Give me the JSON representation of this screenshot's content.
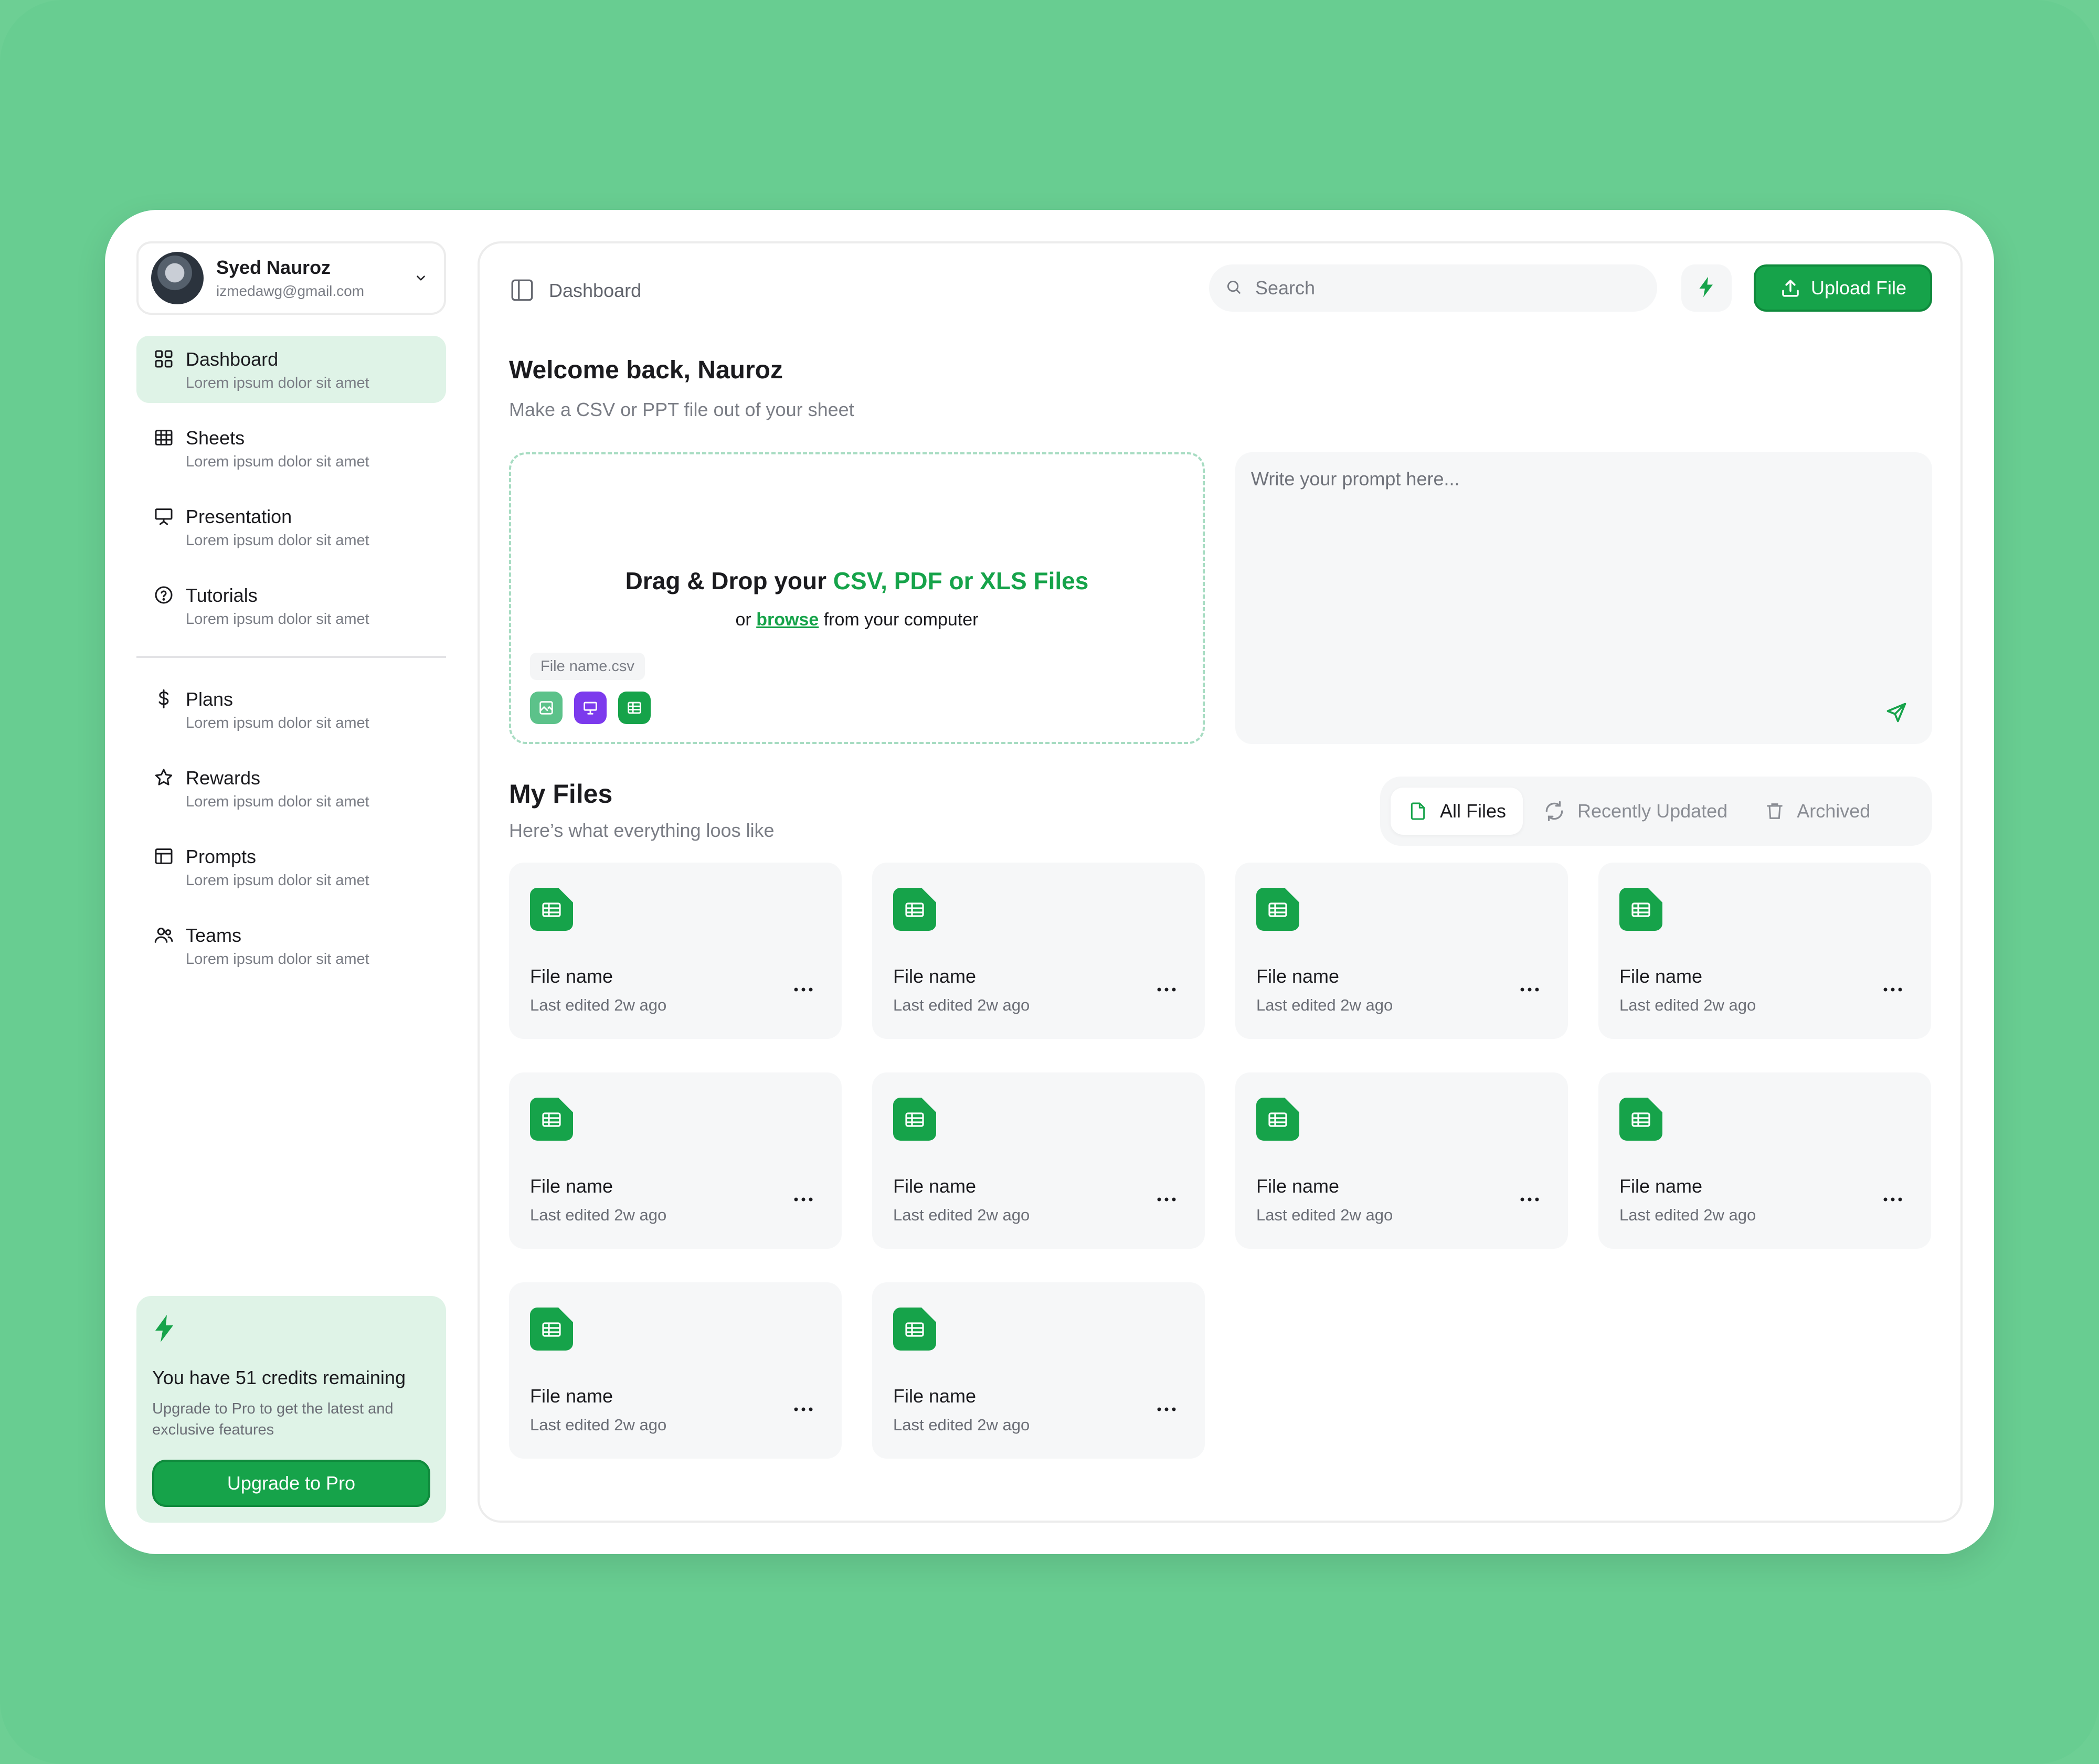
{
  "profile": {
    "name": "Syed Nauroz",
    "email": "izmedawg@gmail.com"
  },
  "nav": {
    "items": [
      {
        "label": "Dashboard",
        "sub": "Lorem ipsum dolor sit amet",
        "icon": "grid-icon",
        "active": true
      },
      {
        "label": "Sheets",
        "sub": "Lorem ipsum dolor sit amet",
        "icon": "table-icon"
      },
      {
        "label": "Presentation",
        "sub": "Lorem ipsum dolor sit amet",
        "icon": "presentation-icon"
      },
      {
        "label": "Tutorials",
        "sub": "Lorem ipsum dolor sit amet",
        "icon": "help-circle-icon"
      }
    ],
    "items2": [
      {
        "label": "Plans",
        "sub": "Lorem ipsum dolor sit amet",
        "icon": "dollar-icon"
      },
      {
        "label": "Rewards",
        "sub": "Lorem ipsum dolor sit amet",
        "icon": "star-icon"
      },
      {
        "label": "Prompts",
        "sub": "Lorem ipsum dolor sit amet",
        "icon": "window-icon"
      },
      {
        "label": "Teams",
        "sub": "Lorem ipsum dolor sit amet",
        "icon": "users-icon"
      }
    ]
  },
  "credits": {
    "title": "You have 51 credits remaining",
    "sub": "Upgrade to Pro to get the latest and exclusive features",
    "button": "Upgrade to Pro"
  },
  "topbar": {
    "title": "Dashboard",
    "search_placeholder": "Search",
    "upload_label": "Upload File"
  },
  "welcome": {
    "title": "Welcome back, Nauroz",
    "sub": "Make a CSV or PPT file out of your sheet"
  },
  "dropzone": {
    "title_prefix": "Drag & Drop your ",
    "title_accent": "CSV, PDF or XLS Files",
    "sub_prefix": "or ",
    "sub_link": "browse",
    "sub_suffix": " from your computer",
    "file_chip": "File name.csv",
    "type_colors": [
      "#5cc28a",
      "#7c3aed",
      "#16a34a"
    ]
  },
  "prompt": {
    "placeholder": "Write your prompt here..."
  },
  "files": {
    "title": "My Files",
    "sub": "Here’s what everything loos like",
    "tabs": [
      {
        "label": "All Files",
        "active": true
      },
      {
        "label": "Recently Updated"
      },
      {
        "label": "Archived"
      }
    ],
    "cards": [
      {
        "name": "File name",
        "meta": "Last edited 2w ago"
      },
      {
        "name": "File name",
        "meta": "Last edited 2w ago"
      },
      {
        "name": "File name",
        "meta": "Last edited 2w ago"
      },
      {
        "name": "File name",
        "meta": "Last edited 2w ago"
      },
      {
        "name": "File name",
        "meta": "Last edited 2w ago"
      },
      {
        "name": "File name",
        "meta": "Last edited 2w ago"
      },
      {
        "name": "File name",
        "meta": "Last edited 2w ago"
      },
      {
        "name": "File name",
        "meta": "Last edited 2w ago"
      },
      {
        "name": "File name",
        "meta": "Last edited 2w ago"
      },
      {
        "name": "File name",
        "meta": "Last edited 2w ago"
      }
    ]
  },
  "colors": {
    "accent": "#16a34a",
    "accent_light": "#dff3e7",
    "background": "#6dcf94"
  }
}
